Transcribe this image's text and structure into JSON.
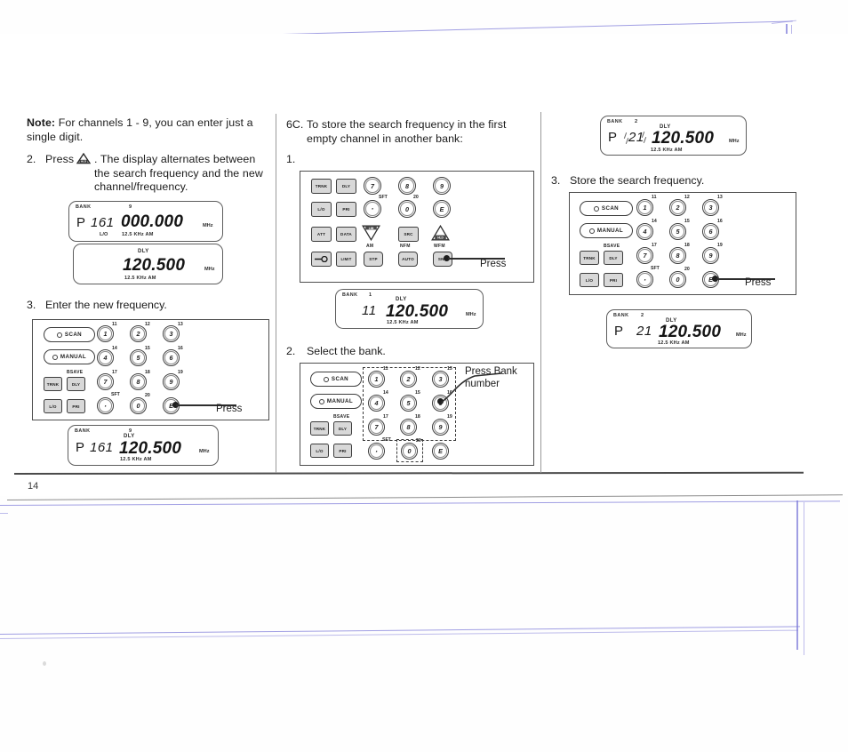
{
  "document": {
    "page_number": "14",
    "type": "scanned-manual-page"
  },
  "columns": {
    "left": {
      "note_label": "Note:",
      "note_text": " For channels 1 - 9, you can enter just a single digit.",
      "step2_num": "2.",
      "step2_text_a": "Press",
      "step2_icon": "hld-triangle-icon",
      "step2_text_b": ". The display alternates between the search frequency and the new channel/frequency.",
      "display_1": {
        "bank_label": "BANK",
        "bank_number": "9",
        "prefix": "P",
        "channel": "161",
        "frequency": "000.000",
        "unit": "MHz",
        "lo": "L/O",
        "mode": "12.5  KHz AM",
        "dly": ""
      },
      "display_2": {
        "dly": "DLY",
        "frequency": "120.500",
        "unit": "MHz",
        "mode": "12.5  KHz AM"
      },
      "step3_num": "3.",
      "step3_text": "Enter the new frequency.",
      "keypad_press_label": "Press",
      "display_3": {
        "bank_label": "BANK",
        "bank_number": "9",
        "dly": "DLY",
        "prefix": "P",
        "channel": "161",
        "frequency": "120.500",
        "unit": "MHz",
        "mode": "12.5  KHz AM"
      }
    },
    "middle": {
      "step6c_num": "6C.",
      "step6c_text": "To store the search frequency in the first empty channel in another bank:",
      "step1_num": "1.",
      "keypad_press_label": "Press",
      "display_1": {
        "bank_label": "BANK",
        "bank_number": "1",
        "dly": "DLY",
        "channel": "11",
        "frequency": "120.500",
        "unit": "MHz",
        "mode": "12.5  KHz AM"
      },
      "step2_num": "2.",
      "step2_text": "Select the bank.",
      "keypad2_press_label": "Press Bank number"
    },
    "right": {
      "display_1": {
        "bank_label": "BANK",
        "bank_number": "2",
        "dly": "DLY",
        "prefix": "P",
        "channel": "21",
        "channel_flashing": true,
        "frequency": "120.500",
        "unit": "MHz",
        "mode": "12.5  KHz AM"
      },
      "step3_num": "3.",
      "step3_text": "Store the search frequency.",
      "keypad_press_label": "Press",
      "display_2": {
        "bank_label": "BANK",
        "bank_number": "2",
        "dly": "DLY",
        "prefix": "P",
        "channel": "21",
        "frequency": "120.500",
        "unit": "MHz",
        "mode": "12.5  KHz AM"
      }
    }
  },
  "keypad_numeric": {
    "pill_scan": "SCAN",
    "pill_manual": "MANUAL",
    "key_trunk": "TRNK",
    "key_dly": "DLY",
    "label_bsave": "BSAVE",
    "key_lo": "L/O",
    "key_pri": "PRI",
    "label_sft": "SFT",
    "key_dot": "·",
    "key_0": "0",
    "key_e": "E",
    "keys": [
      {
        "label": "1",
        "sup": "11"
      },
      {
        "label": "2",
        "sup": "12"
      },
      {
        "label": "3",
        "sup": "13"
      },
      {
        "label": "4",
        "sup": "14"
      },
      {
        "label": "5",
        "sup": "15"
      },
      {
        "label": "6",
        "sup": "16"
      },
      {
        "label": "7",
        "sup": "17"
      },
      {
        "label": "8",
        "sup": "18"
      },
      {
        "label": "9",
        "sup": "19"
      },
      {
        "label": "0",
        "sup": "20"
      }
    ]
  },
  "keypad_function": {
    "row1": [
      "TRNK",
      "DLY",
      "7",
      "8",
      "9"
    ],
    "row2": [
      "L/O",
      "PRI",
      "·",
      "0",
      "E"
    ],
    "row2_sups": [
      "SFT",
      "20"
    ],
    "row3": [
      "ATT",
      "DATA",
      "LIM",
      "SRC",
      "HLD"
    ],
    "row4": [
      "—O",
      "LIMIT",
      "STP",
      "AUTO",
      "SND"
    ],
    "row4_sublabels": [
      "AM",
      "NFM",
      "WFM"
    ],
    "sup_7": "17",
    "sup_8": "18",
    "sup_9": "19"
  },
  "colors": {
    "ink": "#1b1b1b",
    "rule": "#4a4a4a",
    "pen_blue": "#7b78d8",
    "key_face": "#d8d8d8"
  }
}
